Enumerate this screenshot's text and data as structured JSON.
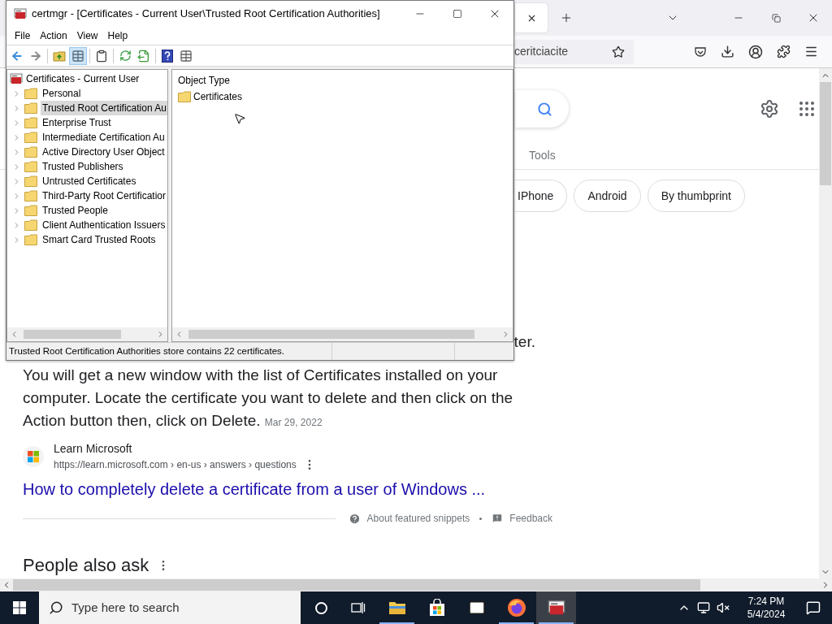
{
  "certmgr": {
    "title": "certmgr - [Certificates - Current User\\Trusted Root Certification Authorities]",
    "menu": [
      "File",
      "Action",
      "View",
      "Help"
    ],
    "toolbar": [
      {
        "kind": "back",
        "pressed": false
      },
      {
        "kind": "forward",
        "pressed": false
      },
      {
        "kind": "up",
        "pressed": false
      },
      {
        "kind": "tree",
        "pressed": true
      },
      {
        "kind": "clipboard",
        "pressed": false
      },
      {
        "kind": "refresh",
        "pressed": false
      },
      {
        "kind": "export",
        "pressed": false
      },
      {
        "kind": "help",
        "pressed": false
      },
      {
        "kind": "view",
        "pressed": false
      }
    ],
    "tree": {
      "label": "Certificates - Current User",
      "children": [
        {
          "label": "Personal",
          "selected": false,
          "expanded": false
        },
        {
          "label": "Trusted Root Certification Au",
          "selected": true,
          "expanded": false
        },
        {
          "label": "Enterprise Trust",
          "selected": false,
          "expanded": false
        },
        {
          "label": "Intermediate Certification Au",
          "selected": false,
          "expanded": false
        },
        {
          "label": "Active Directory User Object",
          "selected": false,
          "expanded": false
        },
        {
          "label": "Trusted Publishers",
          "selected": false,
          "expanded": false
        },
        {
          "label": "Untrusted Certificates",
          "selected": false,
          "expanded": false
        },
        {
          "label": "Third-Party Root Certificatior",
          "selected": false,
          "expanded": false
        },
        {
          "label": "Trusted People",
          "selected": false,
          "expanded": false
        },
        {
          "label": "Client Authentication Issuers",
          "selected": false,
          "expanded": false
        },
        {
          "label": "Smart Card Trusted Roots",
          "selected": false,
          "expanded": false
        }
      ]
    },
    "list": {
      "columns": [
        "Object Type"
      ],
      "rows": [
        {
          "name": "Certificates"
        }
      ]
    },
    "status": "Trusted Root Certification Authorities store contains 22 certificates."
  },
  "browser": {
    "address_fragment": "ceritciacite",
    "tools": "Tools",
    "chips": [
      "IPhone",
      "Android",
      "By thumbprint"
    ],
    "snippet": {
      "fragment": "ter.",
      "text": "You will get a new window with the list of Certificates installed on your computer. Locate the certificate you want to delete and then click on the Action button then, click on Delete.",
      "date": "Mar 29, 2022"
    },
    "source": {
      "name": "Learn Microsoft",
      "url": "https://learn.microsoft.com › en-us › answers › questions"
    },
    "result_title": "How to completely delete a certificate from a user of Windows ...",
    "footer": [
      "About featured snippets",
      "Feedback"
    ],
    "people_also_ask": "People also ask"
  },
  "taskbar": {
    "search_placeholder": "Type here to search",
    "apps": [
      {
        "kind": "explorer",
        "running": true,
        "selected": false
      },
      {
        "kind": "store",
        "running": false,
        "selected": false
      },
      {
        "kind": "mail",
        "running": false,
        "selected": false
      },
      {
        "kind": "firefox",
        "running": true,
        "selected": false
      },
      {
        "kind": "certmgr",
        "running": true,
        "selected": true
      }
    ],
    "time": "7:24 PM",
    "date": "5/4/2024"
  }
}
